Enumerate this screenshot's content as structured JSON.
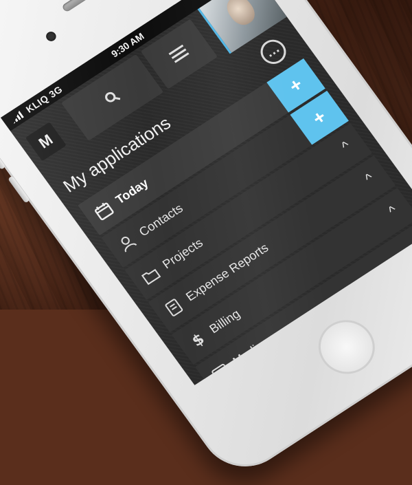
{
  "status_bar": {
    "carrier": "KLIQ",
    "network": "3G",
    "time": "9:30 AM"
  },
  "top_bar": {
    "logo_text": "M",
    "search_icon": "search-icon",
    "menu_icon": "hamburger-menu-icon",
    "avatar_icon": "user-photo",
    "more_icon": "ellipsis-circle-icon"
  },
  "main": {
    "heading": "My applications",
    "apps": [
      {
        "label": "Today",
        "icon": "calendar-icon",
        "action": "add"
      },
      {
        "label": "Contacts",
        "icon": "person-icon",
        "action": "add"
      },
      {
        "label": "Projects",
        "icon": "folder-icon",
        "action": "expand"
      },
      {
        "label": "Expense Reports",
        "icon": "receipt-icon",
        "action": "expand"
      },
      {
        "label": "Billing",
        "icon": "dollar-icon",
        "action": "expand"
      },
      {
        "label": "Media",
        "icon": "media-icon",
        "action": "expand"
      }
    ],
    "add_symbol": "+",
    "expand_symbol": "^"
  },
  "colors": {
    "accent": "#5fc3ee",
    "screen_bg": "#2a2a2a",
    "row_bg": "#333333",
    "phone_body": "#eeeeee",
    "desk": "#6a3520"
  }
}
